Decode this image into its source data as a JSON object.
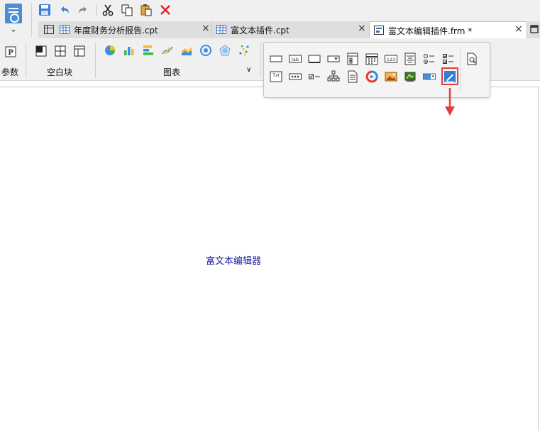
{
  "toolbar": {
    "icons": [
      "app-menu-icon",
      "save-icon",
      "undo-icon",
      "redo-icon",
      "cut-icon",
      "copy-icon",
      "paste-icon",
      "delete-icon"
    ]
  },
  "tabs": [
    {
      "label": "年度财务分析报告.cpt",
      "close": "×",
      "icon": "report-icon",
      "active": false
    },
    {
      "label": "富文本插件.cpt",
      "close": "×",
      "icon": "report-icon",
      "active": false
    },
    {
      "label": "富文本编辑插件.frm *",
      "close": "×",
      "icon": "form-icon",
      "active": true
    }
  ],
  "ribbon": {
    "param_label": "参数",
    "blank_label": "空白块",
    "chart_label": "图表",
    "chart_expand": "∨"
  },
  "canvas": {
    "widget_label": "富文本编辑器"
  },
  "popup": {
    "row1": [
      "text-field-icon",
      "label-icon",
      "button-icon",
      "dropdown-icon",
      "dropdown-tree-icon",
      "date-icon",
      "number-icon",
      "text-area-icon",
      "radio-group-icon",
      "checkbox-group-icon"
    ],
    "row2": [
      "text-widget-icon",
      "password-icon",
      "checkbox-icon",
      "tree-icon",
      "file-icon",
      "video-icon",
      "image-icon",
      "web-icon",
      "dropdown-box-icon",
      "rich-text-editor-icon"
    ],
    "preview_icon": "preview-icon"
  },
  "colors": {
    "accent": "#e63b3b",
    "canvas_text": "#1a1aa6",
    "app_blue": "#4a8ed6"
  }
}
